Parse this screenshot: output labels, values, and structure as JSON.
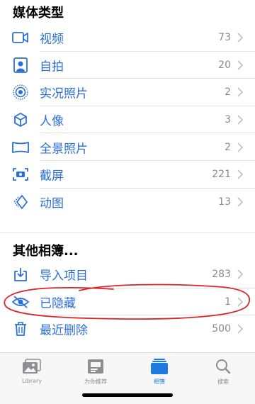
{
  "media_types": {
    "title": "媒体类型",
    "items": [
      {
        "label": "视频",
        "count": "73",
        "icon": "video-icon"
      },
      {
        "label": "自拍",
        "count": "20",
        "icon": "selfie-portrait-icon"
      },
      {
        "label": "实况照片",
        "count": "2",
        "icon": "live-photo-icon"
      },
      {
        "label": "人像",
        "count": "3",
        "icon": "cube-portrait-icon"
      },
      {
        "label": "全景照片",
        "count": "2",
        "icon": "panorama-icon"
      },
      {
        "label": "截屏",
        "count": "221",
        "icon": "screenshot-icon"
      },
      {
        "label": "动图",
        "count": "13",
        "icon": "animated-icon"
      }
    ]
  },
  "other_albums": {
    "title": "其他相簿...",
    "items": [
      {
        "label": "导入项目",
        "count": "283",
        "icon": "import-icon"
      },
      {
        "label": "已隐藏",
        "count": "1",
        "icon": "hidden-eye-icon"
      },
      {
        "label": "最近删除",
        "count": "500",
        "icon": "trash-icon"
      }
    ]
  },
  "tabbar": {
    "tabs": [
      {
        "label": "Library",
        "icon": "library-photos-icon",
        "active": false
      },
      {
        "label": "为你推荐",
        "icon": "for-you-icon",
        "active": false
      },
      {
        "label": "相簿",
        "icon": "albums-icon",
        "active": true
      },
      {
        "label": "搜索",
        "icon": "search-icon",
        "active": false
      }
    ]
  },
  "colors": {
    "accent": "#2d6fd8",
    "tab_active": "#1f7ae0",
    "annotation": "#d9262a",
    "muted": "#8a8a8e"
  }
}
